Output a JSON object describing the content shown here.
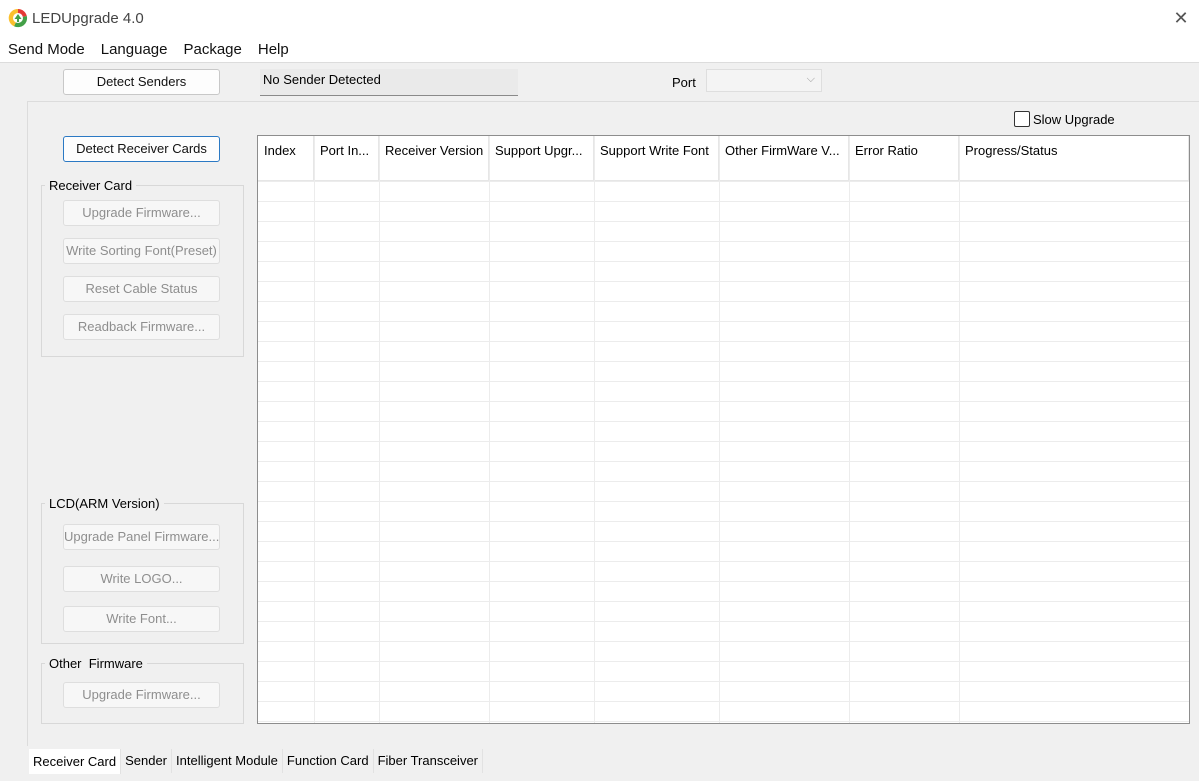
{
  "window": {
    "title": "LEDUpgrade 4.0"
  },
  "menu": [
    "Send Mode",
    "Language",
    "Package",
    "Help"
  ],
  "sender_bar": {
    "detect_label": "Detect Senders",
    "status": "No Sender Detected",
    "port_label": "Port",
    "port_value": ""
  },
  "slow_upgrade": {
    "label": "Slow Upgrade",
    "checked": false
  },
  "detect_receivers_label": "Detect Receiver Cards",
  "groups": {
    "receiver": {
      "title": "Receiver Card",
      "buttons": [
        "Upgrade Firmware...",
        "Write Sorting Font(Preset)",
        "Reset Cable Status",
        "Readback Firmware..."
      ]
    },
    "lcd": {
      "title": "LCD(ARM Version)",
      "buttons": [
        "Upgrade Panel Firmware...",
        "Write LOGO...",
        "Write Font..."
      ]
    },
    "other": {
      "title": "Other  Firmware",
      "buttons": [
        "Upgrade Firmware..."
      ]
    }
  },
  "table": {
    "columns": [
      "Index",
      "Port In...",
      "Receiver Version",
      "Support Upgr...",
      "Support Write Font",
      "Other FirmWare V...",
      "Error Ratio",
      "Progress/Status"
    ],
    "rows": []
  },
  "tabs": [
    "Receiver Card",
    "Sender",
    "Intelligent Module",
    "Function Card",
    "Fiber Transceiver"
  ],
  "active_tab": 0
}
